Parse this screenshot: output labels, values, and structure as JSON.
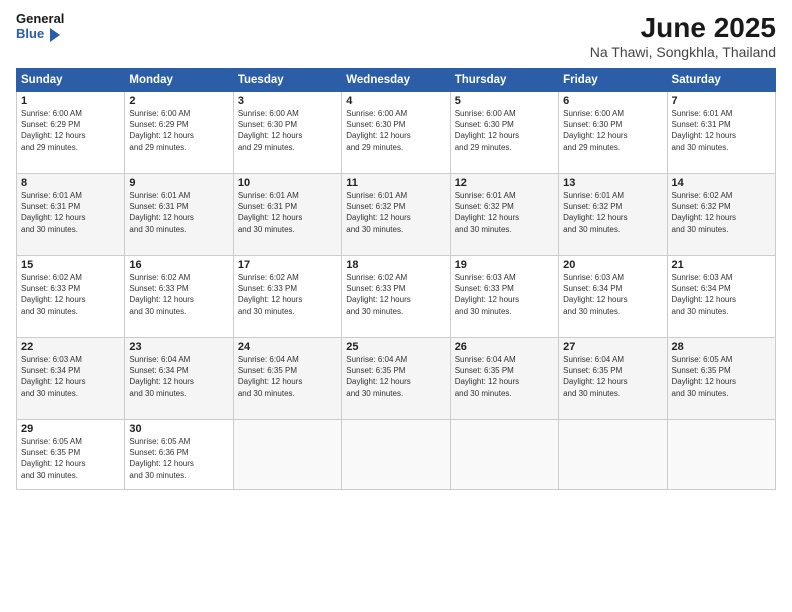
{
  "logo": {
    "line1": "General",
    "line2": "Blue"
  },
  "title": "June 2025",
  "subtitle": "Na Thawi, Songkhla, Thailand",
  "weekdays": [
    "Sunday",
    "Monday",
    "Tuesday",
    "Wednesday",
    "Thursday",
    "Friday",
    "Saturday"
  ],
  "rows": [
    [
      {
        "day": "1",
        "info": "Sunrise: 6:00 AM\nSunset: 6:29 PM\nDaylight: 12 hours\nand 29 minutes."
      },
      {
        "day": "2",
        "info": "Sunrise: 6:00 AM\nSunset: 6:29 PM\nDaylight: 12 hours\nand 29 minutes."
      },
      {
        "day": "3",
        "info": "Sunrise: 6:00 AM\nSunset: 6:30 PM\nDaylight: 12 hours\nand 29 minutes."
      },
      {
        "day": "4",
        "info": "Sunrise: 6:00 AM\nSunset: 6:30 PM\nDaylight: 12 hours\nand 29 minutes."
      },
      {
        "day": "5",
        "info": "Sunrise: 6:00 AM\nSunset: 6:30 PM\nDaylight: 12 hours\nand 29 minutes."
      },
      {
        "day": "6",
        "info": "Sunrise: 6:00 AM\nSunset: 6:30 PM\nDaylight: 12 hours\nand 29 minutes."
      },
      {
        "day": "7",
        "info": "Sunrise: 6:01 AM\nSunset: 6:31 PM\nDaylight: 12 hours\nand 30 minutes."
      }
    ],
    [
      {
        "day": "8",
        "info": "Sunrise: 6:01 AM\nSunset: 6:31 PM\nDaylight: 12 hours\nand 30 minutes."
      },
      {
        "day": "9",
        "info": "Sunrise: 6:01 AM\nSunset: 6:31 PM\nDaylight: 12 hours\nand 30 minutes."
      },
      {
        "day": "10",
        "info": "Sunrise: 6:01 AM\nSunset: 6:31 PM\nDaylight: 12 hours\nand 30 minutes."
      },
      {
        "day": "11",
        "info": "Sunrise: 6:01 AM\nSunset: 6:32 PM\nDaylight: 12 hours\nand 30 minutes."
      },
      {
        "day": "12",
        "info": "Sunrise: 6:01 AM\nSunset: 6:32 PM\nDaylight: 12 hours\nand 30 minutes."
      },
      {
        "day": "13",
        "info": "Sunrise: 6:01 AM\nSunset: 6:32 PM\nDaylight: 12 hours\nand 30 minutes."
      },
      {
        "day": "14",
        "info": "Sunrise: 6:02 AM\nSunset: 6:32 PM\nDaylight: 12 hours\nand 30 minutes."
      }
    ],
    [
      {
        "day": "15",
        "info": "Sunrise: 6:02 AM\nSunset: 6:33 PM\nDaylight: 12 hours\nand 30 minutes."
      },
      {
        "day": "16",
        "info": "Sunrise: 6:02 AM\nSunset: 6:33 PM\nDaylight: 12 hours\nand 30 minutes."
      },
      {
        "day": "17",
        "info": "Sunrise: 6:02 AM\nSunset: 6:33 PM\nDaylight: 12 hours\nand 30 minutes."
      },
      {
        "day": "18",
        "info": "Sunrise: 6:02 AM\nSunset: 6:33 PM\nDaylight: 12 hours\nand 30 minutes."
      },
      {
        "day": "19",
        "info": "Sunrise: 6:03 AM\nSunset: 6:33 PM\nDaylight: 12 hours\nand 30 minutes."
      },
      {
        "day": "20",
        "info": "Sunrise: 6:03 AM\nSunset: 6:34 PM\nDaylight: 12 hours\nand 30 minutes."
      },
      {
        "day": "21",
        "info": "Sunrise: 6:03 AM\nSunset: 6:34 PM\nDaylight: 12 hours\nand 30 minutes."
      }
    ],
    [
      {
        "day": "22",
        "info": "Sunrise: 6:03 AM\nSunset: 6:34 PM\nDaylight: 12 hours\nand 30 minutes."
      },
      {
        "day": "23",
        "info": "Sunrise: 6:04 AM\nSunset: 6:34 PM\nDaylight: 12 hours\nand 30 minutes."
      },
      {
        "day": "24",
        "info": "Sunrise: 6:04 AM\nSunset: 6:35 PM\nDaylight: 12 hours\nand 30 minutes."
      },
      {
        "day": "25",
        "info": "Sunrise: 6:04 AM\nSunset: 6:35 PM\nDaylight: 12 hours\nand 30 minutes."
      },
      {
        "day": "26",
        "info": "Sunrise: 6:04 AM\nSunset: 6:35 PM\nDaylight: 12 hours\nand 30 minutes."
      },
      {
        "day": "27",
        "info": "Sunrise: 6:04 AM\nSunset: 6:35 PM\nDaylight: 12 hours\nand 30 minutes."
      },
      {
        "day": "28",
        "info": "Sunrise: 6:05 AM\nSunset: 6:35 PM\nDaylight: 12 hours\nand 30 minutes."
      }
    ],
    [
      {
        "day": "29",
        "info": "Sunrise: 6:05 AM\nSunset: 6:35 PM\nDaylight: 12 hours\nand 30 minutes."
      },
      {
        "day": "30",
        "info": "Sunrise: 6:05 AM\nSunset: 6:36 PM\nDaylight: 12 hours\nand 30 minutes."
      },
      {
        "day": "",
        "info": ""
      },
      {
        "day": "",
        "info": ""
      },
      {
        "day": "",
        "info": ""
      },
      {
        "day": "",
        "info": ""
      },
      {
        "day": "",
        "info": ""
      }
    ]
  ]
}
